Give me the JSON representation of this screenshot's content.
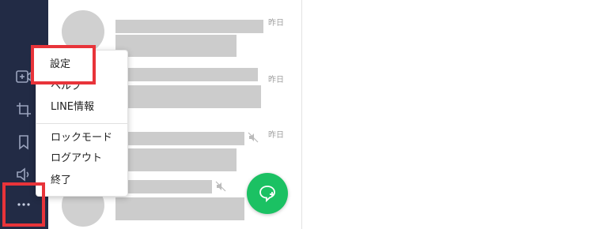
{
  "sidebar": {
    "icons": [
      "add-chat-icon",
      "crop-icon",
      "bookmark-icon",
      "speaker-icon",
      "more-icon"
    ]
  },
  "chat_list": {
    "items": [
      {
        "time": "昨日",
        "muted": false
      },
      {
        "time": "昨日",
        "muted": false
      },
      {
        "time": "昨日",
        "muted": true
      },
      {
        "time": "",
        "muted": true
      }
    ]
  },
  "menu": {
    "items": [
      "設定",
      "ヘルプ",
      "LINE情報",
      "ロックモード",
      "ログアウト",
      "終了"
    ]
  },
  "fab": {
    "icon": "new-chat-icon"
  },
  "colors": {
    "sidebar": "#222b45",
    "fab": "#1bc163",
    "highlight": "#e8343a",
    "placeholder": "#cccccc"
  }
}
